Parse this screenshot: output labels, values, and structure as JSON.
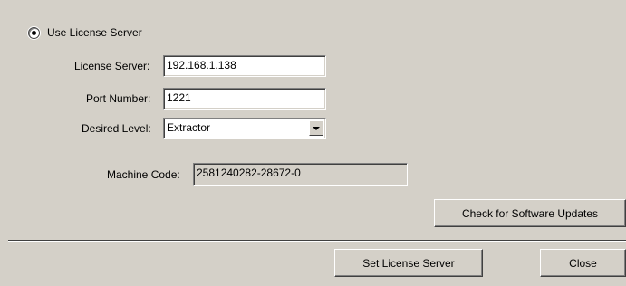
{
  "license_mode": {
    "option_label": "Use License Server",
    "selected": true
  },
  "form": {
    "server_label": "License Server:",
    "server_value": "192.168.1.138",
    "port_label": "Port Number:",
    "port_value": "1221",
    "level_label": "Desired Level:",
    "level_value": "Extractor",
    "machine_code_label": "Machine Code:",
    "machine_code_value": "2581240282-28672-0"
  },
  "buttons": {
    "check_updates": "Check for Software Updates",
    "set_server": "Set License Server",
    "close": "Close"
  }
}
